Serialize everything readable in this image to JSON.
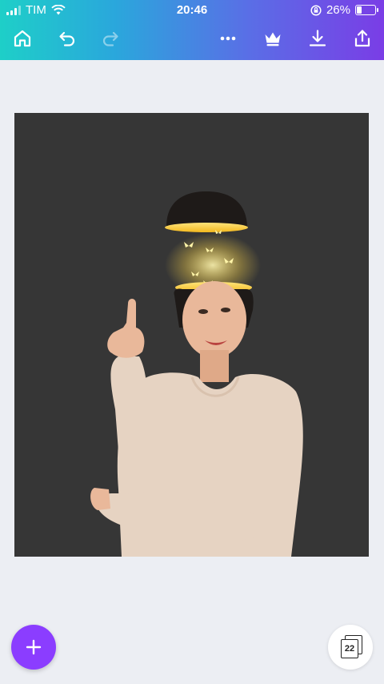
{
  "status_bar": {
    "carrier": "TIM",
    "time": "20:46",
    "battery": "26%",
    "icons": [
      "signal-icon",
      "wifi-icon",
      "orientation-lock-icon",
      "battery-icon"
    ]
  },
  "toolbar": {
    "icons": [
      "home-icon",
      "undo-icon",
      "redo-icon",
      "more-icon",
      "crown-icon",
      "download-icon",
      "share-icon"
    ],
    "redo_enabled": false
  },
  "canvas": {
    "background_color": "#363636",
    "image": "woman-pointing-up-with-glowing-butterflies"
  },
  "bottom": {
    "add_icon": "plus-icon",
    "page_count": "22"
  },
  "colors": {
    "gradient_start": "#1ecfc8",
    "gradient_end": "#7a3de6",
    "fab": "#8b3dff"
  }
}
